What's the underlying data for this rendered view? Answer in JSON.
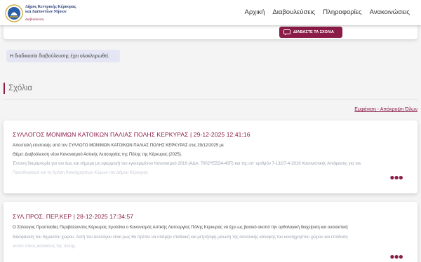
{
  "header": {
    "logo": {
      "line1": "Δήμος Κεντρικής Κέρκυρας",
      "line2": "και Διαποντίων Νήσων",
      "line3": "Διαβούλευση"
    },
    "nav": [
      "Αρχική",
      "Διαβουλεύσεις",
      "Πληροφορίες",
      "Ανακοινώσεις"
    ]
  },
  "read_comments_button": "ΔΙΑΒΑΣΤΕ ΤΑ ΣΧΟΛΙΑ",
  "status_message": "Η διαδικασία διαβούλευσης έχει ολοκληρωθεί.",
  "comments_section": {
    "title": "Σχόλια",
    "toggle_all": "Εμφάνιση - Απόκρυψη Όλων",
    "comments": [
      {
        "title": "ΣΥΛΛΟΓΟΣ ΜΟΝΙΜΩΝ ΚΑΤΟΙΚΩΝ ΠΑΛΙΑΣ ΠΟΛΗΣ ΚΕΡΚΥΡΑΣ | 29-12-2025 12:41:16",
        "lines": [
          "Αποστολή επιστολής από τον ΣΥΛΛΟΓΟ ΜΟΝΙΜΩΝ ΚΑΤΟΙΚΩΝ ΠΑΛΙΑΣ ΠΟΛΗΣ ΚΕΡΚΥΡΑΣ στις 29/12/2025 με",
          "Θέμα: Διαβούλευση νέου Κανονισμού Αστικής Λειτουργίας της Πόλης της  Κέρκυρας (2025).",
          "Έντονη διαμαρτυρία για τον έως και σήμερα μη εφαρμογή του εγκεκριμένου  Κανονισμού 2016 (ΑΔΑ: 7002?ΕΣΩ4-40Π) και της υπ' αριθμόν 7-132/7-4-2016  Κανονιστικής Απόφασης για τον",
          "Προσδιορισμό και τη Χρήση Κοινόχρηστων  Χώρων του Δήμου Κέρκυρας"
        ]
      },
      {
        "title": "ΣΥΛ.ΠΡΟΣ. ΠΕΡ.ΚΕΡ | 28-12-2025 17:34:57",
        "lines": [
          "Ο Σύλλογος Προστασίας Περιβάλλοντος Κέρκυρας προτείνει ο Κανονισμός Αστικής Λειτουργίας Πόλης Κέρκυρας να έχει ως βασικό σκοπό την ορθολογική διαχείριση και ουσιαστική",
          "διασφάλιση του δημοσίου χώρου. Αυτή του συλλόγου είναι ρως θα πρέπει να υπάρξει σταδιακή και μετρήσιμη μείωση της συνολικής κάλυψης του κοινόχρηστου χώρου και επόδοση",
          "αυτού στους κατοίκους της πόλης."
        ]
      }
    ]
  },
  "icons": {
    "comment_button": "chat-bubble-icon",
    "more_options": "more-dots-icon"
  },
  "colors": {
    "accent": "#8b1b47",
    "brand_blue": "#2a3f7a",
    "info_bg": "#e4e7f3"
  }
}
